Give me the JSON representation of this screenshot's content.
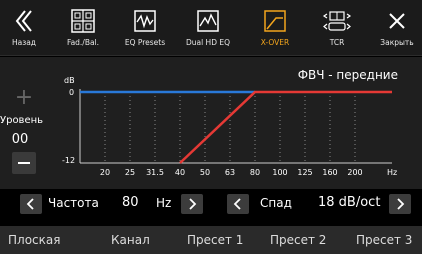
{
  "toolbar": {
    "back_label": "Назад",
    "fadbal_label": "Fad./Bal.",
    "eq_presets_label": "EQ Presets",
    "dual_hd_eq_label": "Dual HD EQ",
    "xover_label": "X-OVER",
    "tcr_label": "TCR",
    "close_label": "Закрыть"
  },
  "chart": {
    "title": "ФВЧ - передние",
    "y_unit": "dB",
    "y_top": "0",
    "y_bottom": "-12",
    "x_unit": "Hz",
    "x_ticks": [
      "20",
      "25",
      "31.5",
      "40",
      "50",
      "63",
      "80",
      "100",
      "125",
      "160",
      "200"
    ]
  },
  "chart_data": {
    "type": "line",
    "title": "ФВЧ - передние",
    "ylabel": "dB",
    "xlabel": "Hz",
    "x_categories": [
      "20",
      "25",
      "31.5",
      "40",
      "50",
      "63",
      "80",
      "100",
      "125",
      "160",
      "200"
    ],
    "ylim": [
      -12,
      0
    ],
    "grid": true,
    "series": [
      {
        "color": "#e53935",
        "points": [
          [
            "40",
            -12
          ],
          [
            "80",
            0
          ],
          [
            "200",
            0
          ]
        ]
      }
    ],
    "reference_line": {
      "color": "#2979d9",
      "y": 0
    }
  },
  "side": {
    "plus": "+",
    "level_label": "Уровень",
    "level_value": "00"
  },
  "controls": {
    "freq_label": "Частота",
    "freq_value": "80",
    "freq_unit": "Hz",
    "slope_label": "Спад",
    "slope_value": "18 dB/oct"
  },
  "presets": [
    "Плоская",
    "Канал",
    "Пресет 1",
    "Пресет 2",
    "Пресет 3"
  ],
  "colors": {
    "accent": "#f3a51c",
    "filter_line": "#e53935",
    "flat_line": "#2979d9"
  }
}
